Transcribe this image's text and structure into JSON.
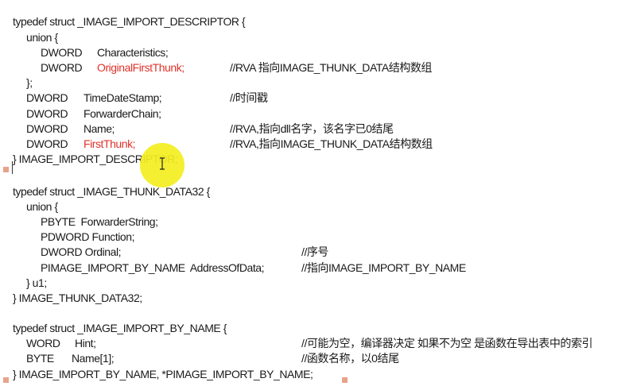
{
  "lines": [
    {
      "segs": [
        {
          "t": "typedef struct _IMAGE_IMPORT_DESCRIPTOR {"
        }
      ]
    },
    {
      "segs": [
        {
          "t": "union {"
        }
      ]
    },
    {
      "segs": [
        {
          "t": "DWORD"
        },
        {
          "t": "Characteristics;"
        }
      ]
    },
    {
      "segs": [
        {
          "t": "DWORD"
        },
        {
          "t": "OriginalFirstThunk;",
          "red": true
        },
        {
          "t": "//RVA 指向IMAGE_THUNK_DATA结构数组"
        }
      ]
    },
    {
      "segs": [
        {
          "t": "};"
        }
      ]
    },
    {
      "segs": [
        {
          "t": "DWORD"
        },
        {
          "t": "TimeDateStamp;"
        },
        {
          "t": "//时间戳"
        }
      ]
    },
    {
      "segs": [
        {
          "t": "DWORD"
        },
        {
          "t": "ForwarderChain;"
        }
      ]
    },
    {
      "segs": [
        {
          "t": "DWORD"
        },
        {
          "t": "Name;"
        },
        {
          "t": "//RVA,指向dll名字，该名字已0结尾"
        }
      ]
    },
    {
      "segs": [
        {
          "t": "DWORD"
        },
        {
          "t": "FirstThunk;",
          "red": true
        },
        {
          "t": "//RVA,指向IMAGE_THUNK_DATA结构数组"
        }
      ]
    },
    {
      "segs": [
        {
          "t": "} IMAGE_IMPORT_DESCRIPTOR;"
        }
      ]
    },
    {
      "segs": [
        {
          "t": ""
        }
      ]
    },
    {
      "segs": [
        {
          "t": "typedef struct _IMAGE_THUNK_DATA32 {"
        }
      ]
    },
    {
      "segs": [
        {
          "t": "union {"
        }
      ]
    },
    {
      "segs": [
        {
          "t": "PBYTE  ForwarderString;"
        }
      ]
    },
    {
      "segs": [
        {
          "t": "PDWORD Function;"
        }
      ]
    },
    {
      "segs": [
        {
          "t": "DWORD Ordinal;"
        },
        {
          "t": "//序号"
        }
      ]
    },
    {
      "segs": [
        {
          "t": "PIMAGE_IMPORT_BY_NAME  AddressOfData;"
        },
        {
          "t": "//指向IMAGE_IMPORT_BY_NAME"
        }
      ]
    },
    {
      "segs": [
        {
          "t": "} u1;"
        }
      ]
    },
    {
      "segs": [
        {
          "t": "} IMAGE_THUNK_DATA32;"
        }
      ]
    },
    {
      "segs": [
        {
          "t": ""
        }
      ]
    },
    {
      "segs": [
        {
          "t": "typedef struct _IMAGE_IMPORT_BY_NAME {"
        }
      ]
    },
    {
      "segs": [
        {
          "t": "WORD"
        },
        {
          "t": "Hint;"
        },
        {
          "t": "//可能为空，编译器决定 如果不为空 是函数在导出表中的索引"
        }
      ]
    },
    {
      "segs": [
        {
          "t": "BYTE"
        },
        {
          "t": "Name[1];"
        },
        {
          "t": "//函数名称，以0结尾"
        }
      ]
    },
    {
      "segs": [
        {
          "t": "} IMAGE_IMPORT_BY_NAME, *PIMAGE_IMPORT_BY_NAME;"
        }
      ]
    }
  ],
  "icons": {
    "ibeam": "text-cursor-icon",
    "highlight": "cursor-highlight"
  },
  "colors": {
    "text": "#1a1a1a",
    "keyword_highlight": "#e0322b",
    "cursor_highlight": "#f3ee1f",
    "margin_marker": "#e7a38a"
  }
}
